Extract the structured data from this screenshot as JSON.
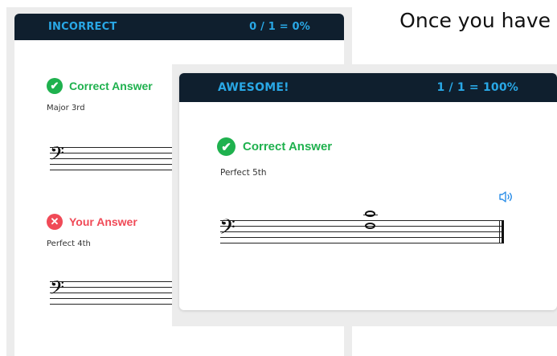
{
  "caption": "Once you have",
  "back_card": {
    "header": {
      "status": "INCORRECT",
      "score": "0 / 1 = 0%"
    },
    "correct": {
      "heading": "Correct Answer",
      "answer": "Major 3rd"
    },
    "yours": {
      "heading": "Your Answer",
      "answer": "Perfect 4th"
    }
  },
  "front_card": {
    "header": {
      "status": "AWESOME!",
      "score": "1 / 1 = 100%"
    },
    "correct": {
      "heading": "Correct Answer",
      "answer": "Perfect 5th"
    }
  },
  "icons": {
    "check": "check-circle-icon",
    "cross": "x-circle-icon",
    "speaker": "speaker-icon",
    "clef": "bass-clef-icon"
  },
  "colors": {
    "header_bg": "#0f1f2e",
    "header_text": "#29a8e6",
    "correct": "#1fb14e",
    "incorrect": "#f04a57",
    "speaker": "#2b8ee8"
  }
}
